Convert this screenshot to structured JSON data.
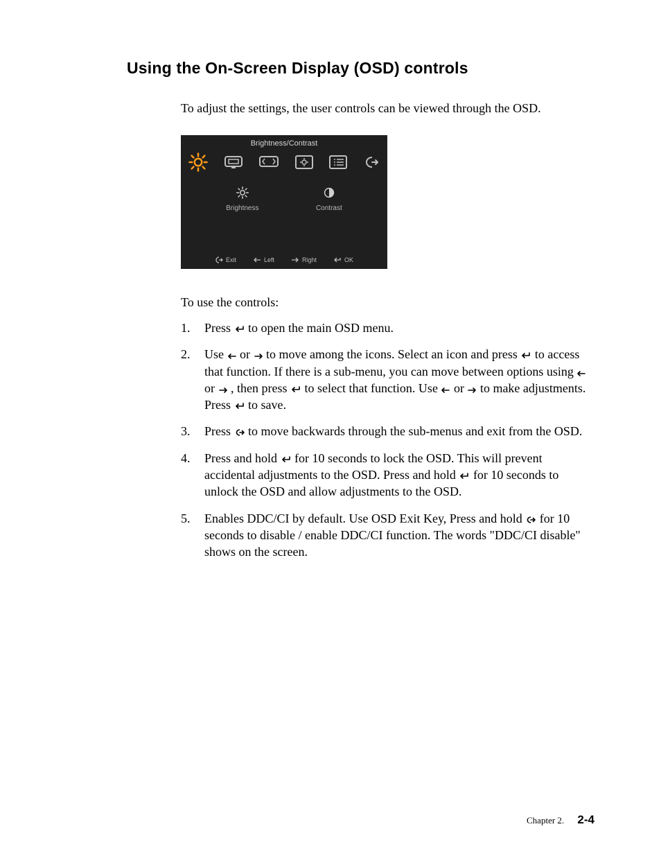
{
  "heading": "Using the On-Screen Display (OSD) controls",
  "intro": "To adjust the settings,  the user controls can be viewed through the OSD.",
  "osd": {
    "title": "Brightness/Contrast",
    "sub_brightness": "Brightness",
    "sub_contrast": "Contrast",
    "footer_exit": "Exit",
    "footer_left": "Left",
    "footer_right": "Right",
    "footer_ok": "OK"
  },
  "to_use": "To use the controls:",
  "items": {
    "1": {
      "num": "1.",
      "a": "Press ",
      "b": " to open the main OSD menu."
    },
    "2": {
      "num": "2.",
      "a": "Use ",
      "b": " or ",
      "c": " to move among the icons. Select an icon and press ",
      "d": " to access that function. If there is a sub-menu, you can move between options using ",
      "e": " or ",
      "f": ", then press ",
      "g": " to select that function. Use ",
      "h": " or ",
      "i": " to make adjustments. Press ",
      "j": " to save."
    },
    "3": {
      "num": "3.",
      "a": "Press ",
      "b": " to move backwards through the sub-menus and exit from the OSD."
    },
    "4": {
      "num": "4.",
      "a": "Press and hold  ",
      "b": " for 10 seconds to lock the OSD. This will prevent accidental adjustments to the OSD. Press and hold ",
      "c": " for 10 seconds to unlock the OSD and allow adjustments to the OSD."
    },
    "5": {
      "num": "5.",
      "a": "Enables DDC/CI by default. Use OSD Exit Key,  Press and hold ",
      "b": " for 10 seconds to disable / enable DDC/CI function. The words \"DDC/CI disable\" shows on the screen."
    }
  },
  "footer": {
    "chapter": "Chapter 2.",
    "page": "2-4"
  }
}
